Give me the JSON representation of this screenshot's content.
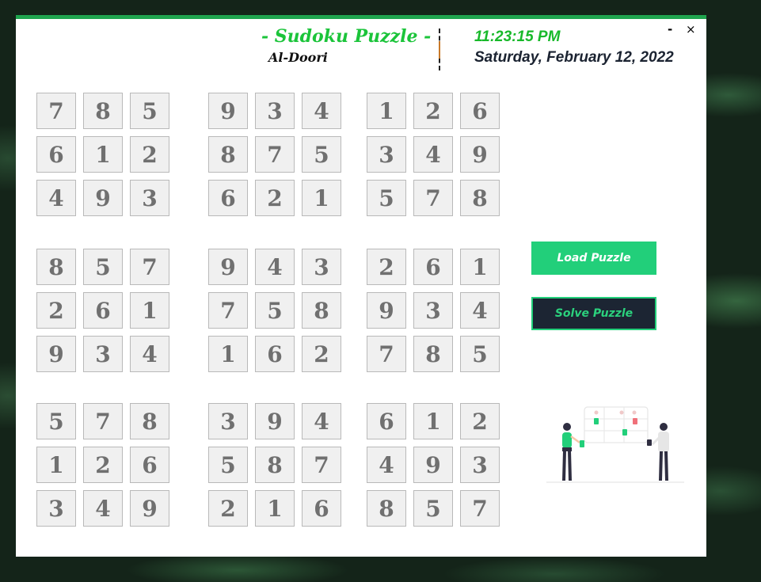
{
  "header": {
    "title": "- Sudoku Puzzle -",
    "author": "Al-Doori",
    "time": "11:23:15 PM",
    "date": "Saturday, February 12, 2022"
  },
  "window_controls": {
    "minimize": "-",
    "close": "×"
  },
  "grid": [
    [
      "7",
      "8",
      "5",
      "9",
      "3",
      "4",
      "1",
      "2",
      "6"
    ],
    [
      "6",
      "1",
      "2",
      "8",
      "7",
      "5",
      "3",
      "4",
      "9"
    ],
    [
      "4",
      "9",
      "3",
      "6",
      "2",
      "1",
      "5",
      "7",
      "8"
    ],
    [
      "8",
      "5",
      "7",
      "9",
      "4",
      "3",
      "2",
      "6",
      "1"
    ],
    [
      "2",
      "6",
      "1",
      "7",
      "5",
      "8",
      "9",
      "3",
      "4"
    ],
    [
      "9",
      "3",
      "4",
      "1",
      "6",
      "2",
      "7",
      "8",
      "5"
    ],
    [
      "5",
      "7",
      "8",
      "3",
      "9",
      "4",
      "6",
      "1",
      "2"
    ],
    [
      "1",
      "2",
      "6",
      "5",
      "8",
      "7",
      "4",
      "9",
      "3"
    ],
    [
      "3",
      "4",
      "9",
      "2",
      "1",
      "6",
      "8",
      "5",
      "7"
    ]
  ],
  "buttons": {
    "load": "Load Puzzle",
    "solve": "Solve Puzzle"
  },
  "colors": {
    "accent_green": "#22cf7a",
    "title_green": "#1bc43a",
    "dark_navy": "#1c2533",
    "cell_bg": "#f0f0f0",
    "cell_text": "#707070"
  },
  "illustration": "people-with-board-illustration"
}
